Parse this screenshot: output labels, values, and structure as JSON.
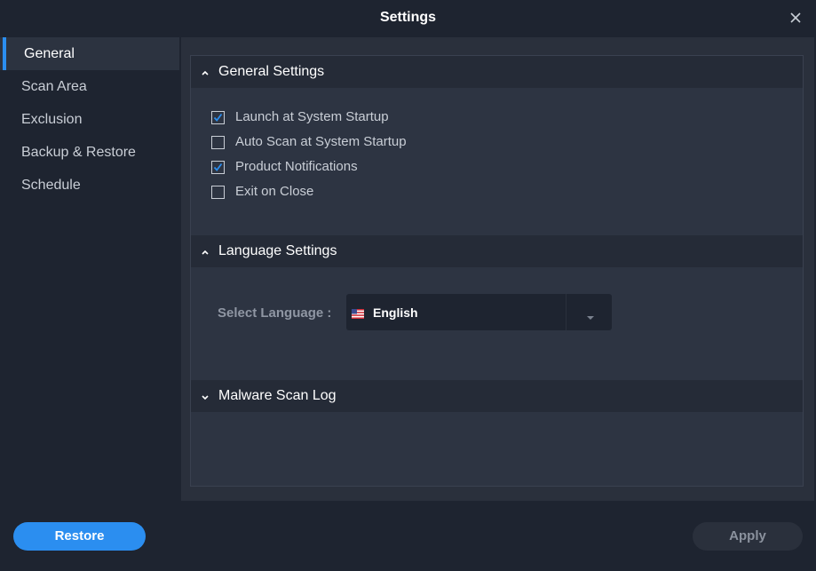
{
  "window": {
    "title": "Settings",
    "close_icon": "close-icon"
  },
  "sidebar": {
    "items": [
      {
        "label": "General",
        "active": true
      },
      {
        "label": "Scan Area",
        "active": false
      },
      {
        "label": "Exclusion",
        "active": false
      },
      {
        "label": "Backup & Restore",
        "active": false
      },
      {
        "label": "Schedule",
        "active": false
      }
    ]
  },
  "general_settings": {
    "header": "General Settings",
    "expanded": true,
    "options": [
      {
        "label": "Launch at System Startup",
        "checked": true
      },
      {
        "label": "Auto Scan at System Startup",
        "checked": false
      },
      {
        "label": "Product Notifications",
        "checked": true
      },
      {
        "label": "Exit on Close",
        "checked": false
      }
    ]
  },
  "language_settings": {
    "header": "Language Settings",
    "expanded": true,
    "select_label": "Select Language :",
    "selected_value": "English",
    "flag_icon": "us-flag-icon",
    "arrow_icon": "chevron-down-icon"
  },
  "malware_scan_log": {
    "header": "Malware Scan Log",
    "expanded": false
  },
  "footer": {
    "restore_label": "Restore",
    "apply_label": "Apply"
  },
  "colors": {
    "accent": "#2b8ef0",
    "background": "#1e2430",
    "panel": "#2d3442"
  }
}
